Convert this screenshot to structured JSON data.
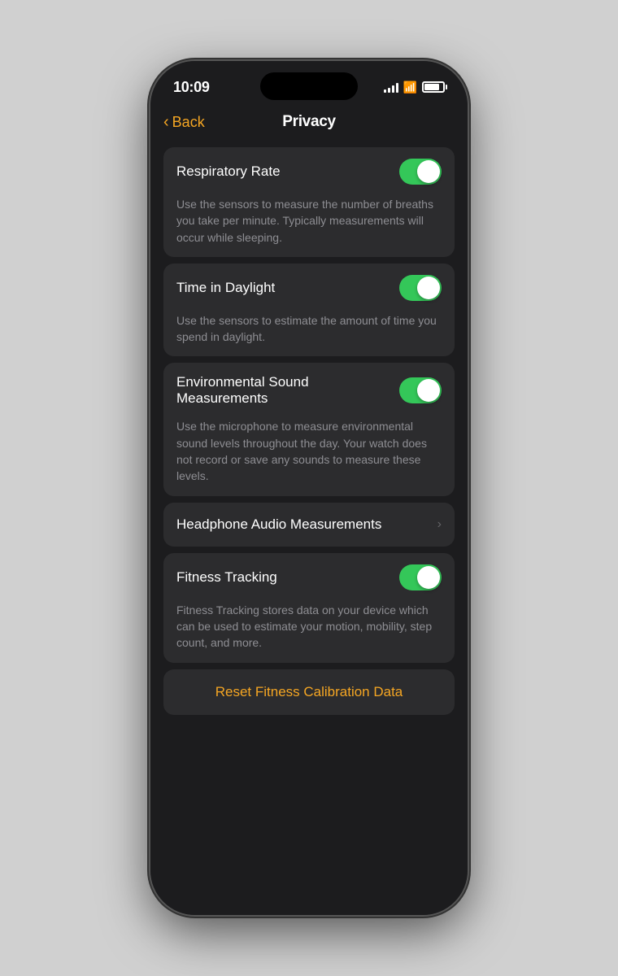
{
  "statusBar": {
    "time": "10:09",
    "signalBars": [
      4,
      6,
      8,
      10,
      12
    ],
    "battery": 75
  },
  "navigation": {
    "backLabel": "Back",
    "title": "Privacy"
  },
  "settings": [
    {
      "id": "respiratory-rate",
      "label": "Respiratory Rate",
      "type": "toggle",
      "enabled": true,
      "description": "Use the sensors to measure the number of breaths you take per minute. Typically measurements will occur while sleeping."
    },
    {
      "id": "time-in-daylight",
      "label": "Time in Daylight",
      "type": "toggle",
      "enabled": true,
      "description": "Use the sensors to estimate the amount of time you spend in daylight."
    },
    {
      "id": "environmental-sound",
      "label": "Environmental Sound Measurements",
      "type": "toggle",
      "enabled": true,
      "description": "Use the microphone to measure environmental sound levels throughout the day. Your watch does not record or save any sounds to measure these levels."
    },
    {
      "id": "headphone-audio",
      "label": "Headphone Audio Measurements",
      "type": "chevron",
      "enabled": null,
      "description": null
    },
    {
      "id": "fitness-tracking",
      "label": "Fitness Tracking",
      "type": "toggle",
      "enabled": true,
      "description": "Fitness Tracking stores data on your device which can be used to estimate your motion, mobility, step count, and more."
    }
  ],
  "resetButton": {
    "label": "Reset Fitness Calibration Data"
  },
  "colors": {
    "toggleOn": "#34c759",
    "accent": "#f5a623",
    "background": "#1c1c1e",
    "cardBackground": "#2c2c2e",
    "textPrimary": "#ffffff",
    "textSecondary": "#8e8e93",
    "chevron": "#636366"
  }
}
